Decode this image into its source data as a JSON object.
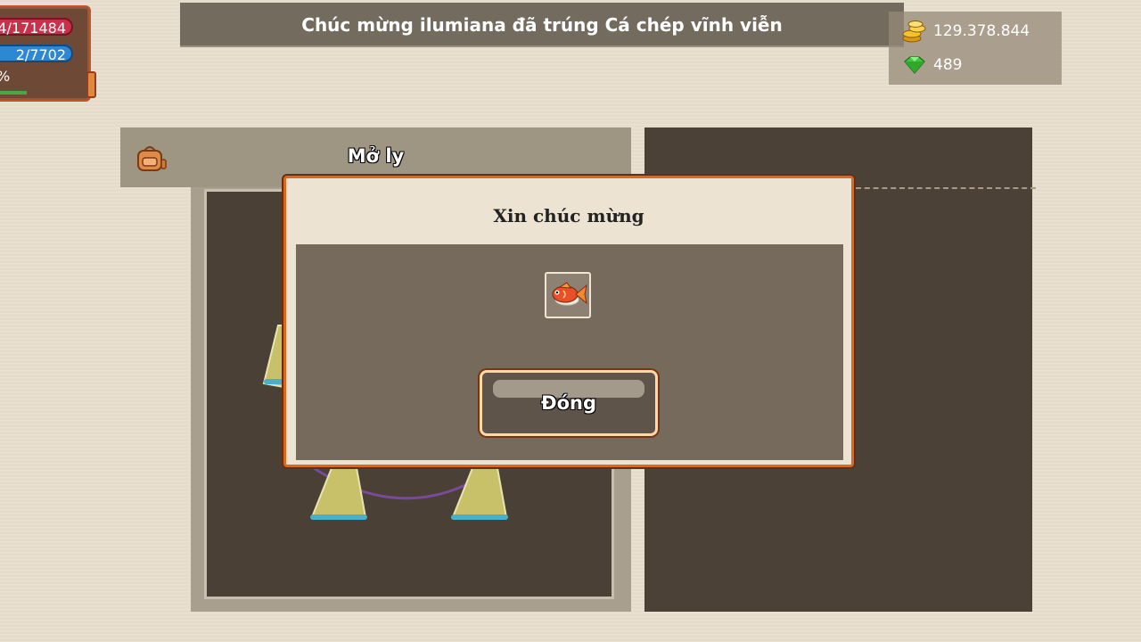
{
  "stats": {
    "hp_text": "4/171484",
    "mp_text": "2/7702",
    "exp_text": "%"
  },
  "announcement": "Chúc mừng ilumiana đã trúng Cá chép vĩnh viễn",
  "currency": {
    "gold": "129.378.844",
    "gems": "489"
  },
  "main_window": {
    "title": "Mở ly"
  },
  "dialog": {
    "title": "Xin chúc mừng",
    "reward_icon": "carp-fish-icon",
    "close_label": "Đóng"
  },
  "colors": {
    "dialog_border": "#d8691f",
    "hp": "#c8314a",
    "mp": "#2d87d2",
    "gem": "#3ec83a",
    "gold": "#f2c230"
  }
}
